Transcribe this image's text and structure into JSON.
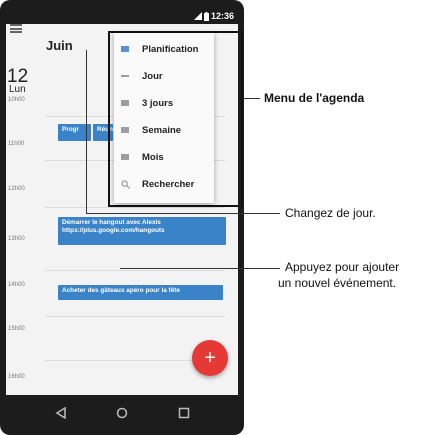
{
  "status": {
    "time": "12:36"
  },
  "calendar": {
    "month": "Juin",
    "day_number": "12",
    "day_name": "Lun",
    "hours": [
      "10h00",
      "11h00",
      "12h00",
      "13h00",
      "14h00",
      "15h00",
      "16h00"
    ],
    "events": [
      {
        "title": "Progr",
        "detail": ""
      },
      {
        "title": "Réun",
        "detail": ""
      },
      {
        "title": "Démarrer le hangout avec Alexis",
        "detail": "https://plus.google.com/hangouts"
      },
      {
        "title": "Acheter des gâteaux apéro pour la fête",
        "detail": ""
      }
    ]
  },
  "menu": {
    "items": [
      {
        "label": "Planification",
        "icon": "schedule-icon"
      },
      {
        "label": "Jour",
        "icon": "day-icon"
      },
      {
        "label": "3 jours",
        "icon": "three-day-icon"
      },
      {
        "label": "Semaine",
        "icon": "week-icon"
      },
      {
        "label": "Mois",
        "icon": "month-icon"
      },
      {
        "label": "Rechercher",
        "icon": "search-icon"
      }
    ]
  },
  "fab": {
    "label": "+"
  },
  "callouts": {
    "menu": "Menu de l'agenda",
    "day": "Changez de jour.",
    "add_line1": "Appuyez pour ajouter",
    "add_line2": "un nouvel événement."
  },
  "colors": {
    "accent": "#3a83c8",
    "fab": "#e53935",
    "frame": "#1c1c1c"
  }
}
